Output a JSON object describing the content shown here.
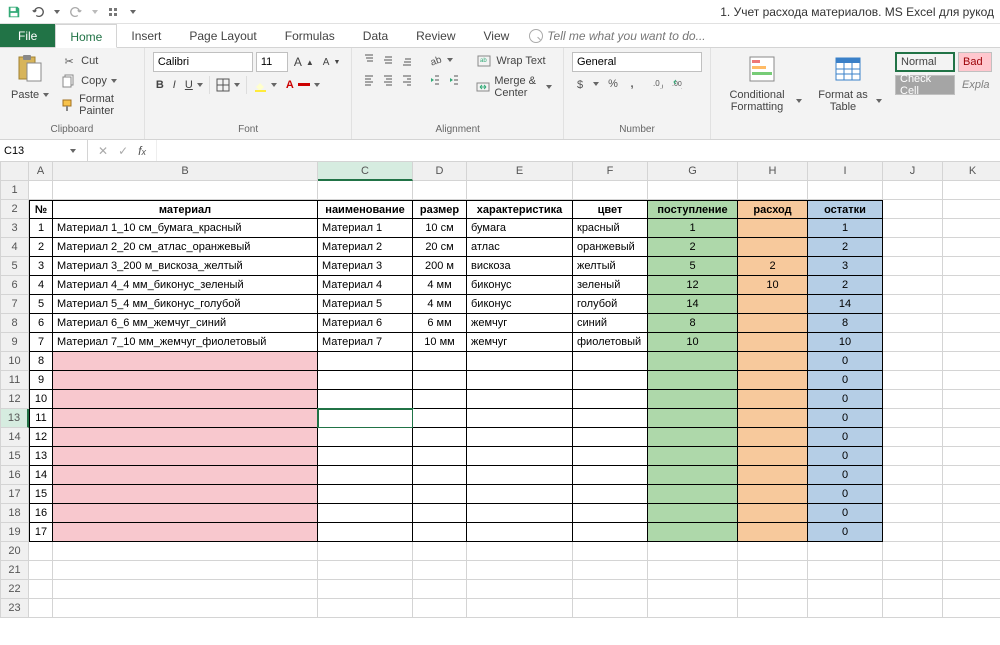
{
  "qat": {
    "title": "1. Учет расхода материалов. MS Excel для рукод"
  },
  "tabs": {
    "file": "File",
    "home": "Home",
    "insert": "Insert",
    "pagelayout": "Page Layout",
    "formulas": "Formulas",
    "data": "Data",
    "review": "Review",
    "view": "View",
    "tellme": "Tell me what you want to do..."
  },
  "ribbon": {
    "clipboard": {
      "label": "Clipboard",
      "paste": "Paste",
      "cut": "Cut",
      "copy": "Copy",
      "painter": "Format Painter"
    },
    "font": {
      "label": "Font",
      "name": "Calibri",
      "size": "11"
    },
    "alignment": {
      "label": "Alignment",
      "wrap": "Wrap Text",
      "merge": "Merge & Center"
    },
    "number": {
      "label": "Number",
      "format": "General"
    },
    "styles": {
      "cond": "Conditional Formatting",
      "table": "Format as Table",
      "normal": "Normal",
      "bad": "Bad",
      "check": "Check Cell",
      "expl": "Expla"
    }
  },
  "fbar": {
    "cellref": "C13"
  },
  "columns": [
    "A",
    "B",
    "C",
    "D",
    "E",
    "F",
    "G",
    "H",
    "I",
    "J",
    "K"
  ],
  "rowcount": 23,
  "selected": {
    "row": 13,
    "colLetter": "C"
  },
  "headers": {
    "A": "№",
    "B": "материал",
    "C": "наименование",
    "D": "размер",
    "E": "характеристика",
    "F": "цвет",
    "G": "поступление",
    "H": "расход",
    "I": "остатки"
  },
  "rows": [
    {
      "n": "1",
      "b": "Материал 1_10 см_бумага_красный",
      "c": "Материал 1",
      "d": "10 см",
      "e": "бумага",
      "f": "красный",
      "g": "1",
      "h": "",
      "i": "1"
    },
    {
      "n": "2",
      "b": "Материал 2_20 см_атлас_оранжевый",
      "c": "Материал 2",
      "d": "20 см",
      "e": "атлас",
      "f": "оранжевый",
      "g": "2",
      "h": "",
      "i": "2"
    },
    {
      "n": "3",
      "b": "Материал 3_200 м_вискоза_желтый",
      "c": "Материал 3",
      "d": "200 м",
      "e": "вискоза",
      "f": "желтый",
      "g": "5",
      "h": "2",
      "i": "3"
    },
    {
      "n": "4",
      "b": "Материал 4_4 мм_биконус_зеленый",
      "c": "Материал 4",
      "d": "4 мм",
      "e": "биконус",
      "f": "зеленый",
      "g": "12",
      "h": "10",
      "i": "2"
    },
    {
      "n": "5",
      "b": "Материал 5_4 мм_биконус_голубой",
      "c": "Материал 5",
      "d": "4 мм",
      "e": "биконус",
      "f": "голубой",
      "g": "14",
      "h": "",
      "i": "14"
    },
    {
      "n": "6",
      "b": "Материал 6_6 мм_жемчуг_синий",
      "c": "Материал 6",
      "d": "6 мм",
      "e": "жемчуг",
      "f": "синий",
      "g": "8",
      "h": "",
      "i": "8"
    },
    {
      "n": "7",
      "b": "Материал 7_10 мм_жемчуг_фиолетовый",
      "c": "Материал 7",
      "d": "10 мм",
      "e": "жемчуг",
      "f": "фиолетовый",
      "g": "10",
      "h": "",
      "i": "10"
    },
    {
      "n": "8",
      "b": "",
      "c": "",
      "d": "",
      "e": "",
      "f": "",
      "g": "",
      "h": "",
      "i": "0"
    },
    {
      "n": "9",
      "b": "",
      "c": "",
      "d": "",
      "e": "",
      "f": "",
      "g": "",
      "h": "",
      "i": "0"
    },
    {
      "n": "10",
      "b": "",
      "c": "",
      "d": "",
      "e": "",
      "f": "",
      "g": "",
      "h": "",
      "i": "0"
    },
    {
      "n": "11",
      "b": "",
      "c": "",
      "d": "",
      "e": "",
      "f": "",
      "g": "",
      "h": "",
      "i": "0"
    },
    {
      "n": "12",
      "b": "",
      "c": "",
      "d": "",
      "e": "",
      "f": "",
      "g": "",
      "h": "",
      "i": "0"
    },
    {
      "n": "13",
      "b": "",
      "c": "",
      "d": "",
      "e": "",
      "f": "",
      "g": "",
      "h": "",
      "i": "0"
    },
    {
      "n": "14",
      "b": "",
      "c": "",
      "d": "",
      "e": "",
      "f": "",
      "g": "",
      "h": "",
      "i": "0"
    },
    {
      "n": "15",
      "b": "",
      "c": "",
      "d": "",
      "e": "",
      "f": "",
      "g": "",
      "h": "",
      "i": "0"
    },
    {
      "n": "16",
      "b": "",
      "c": "",
      "d": "",
      "e": "",
      "f": "",
      "g": "",
      "h": "",
      "i": "0"
    },
    {
      "n": "17",
      "b": "",
      "c": "",
      "d": "",
      "e": "",
      "f": "",
      "g": "",
      "h": "",
      "i": "0"
    }
  ]
}
